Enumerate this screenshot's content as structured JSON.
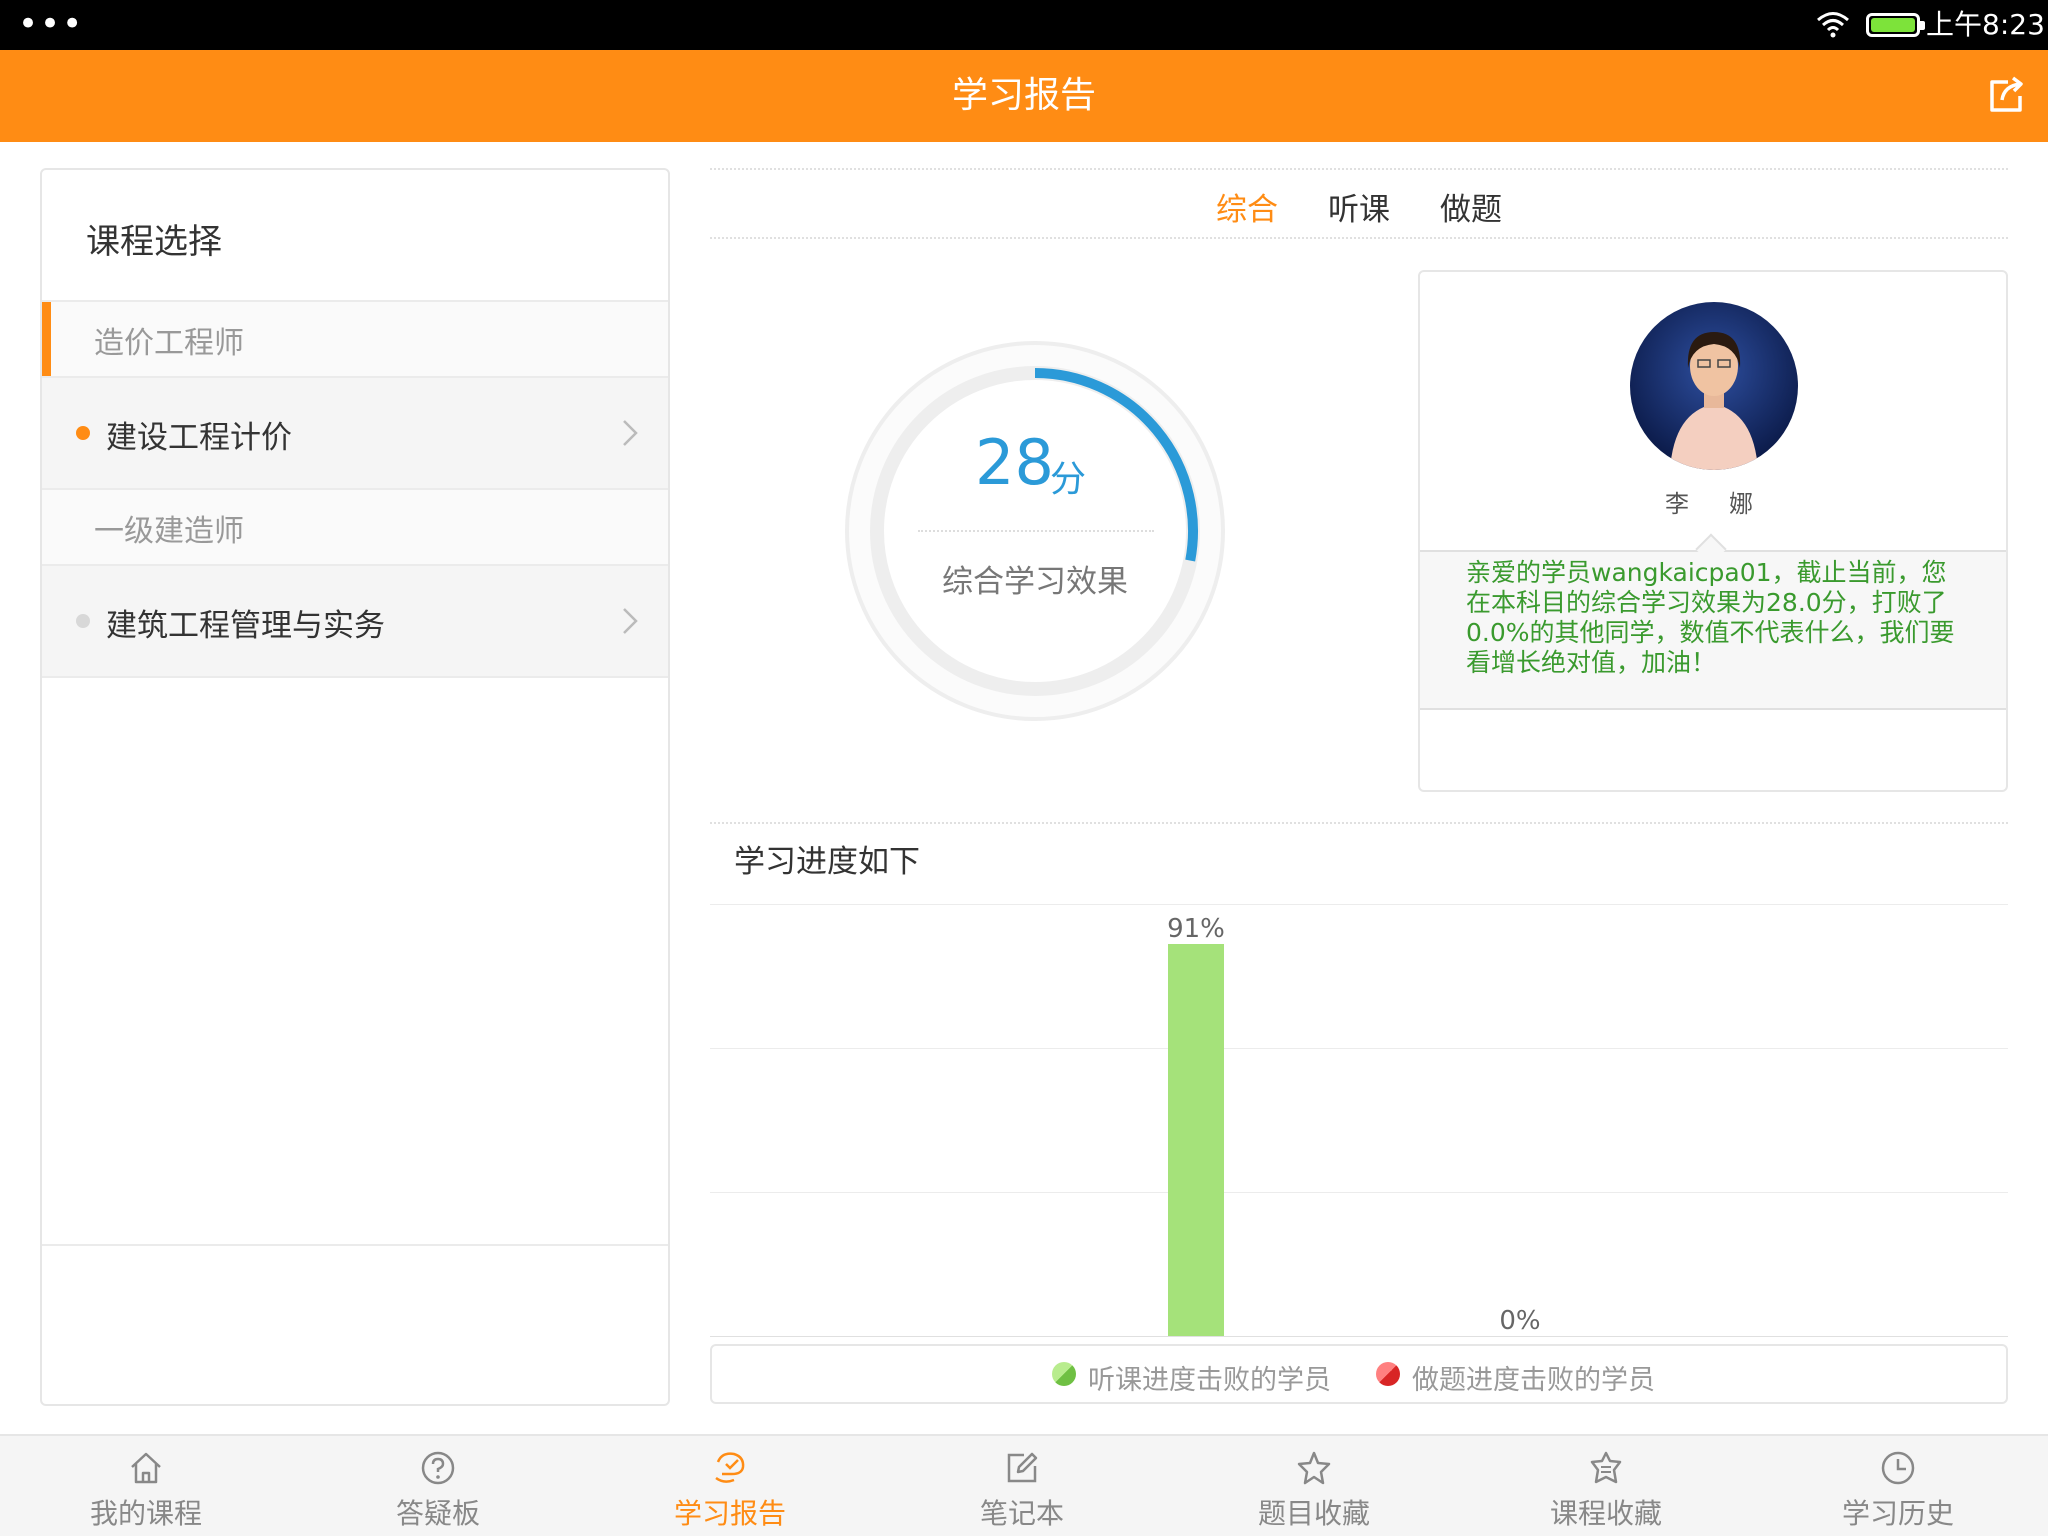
{
  "status_bar": {
    "time": "上午8:23",
    "menu_dots": "•••"
  },
  "header": {
    "title": "学习报告",
    "share_icon": "share-icon"
  },
  "left_panel": {
    "title": "课程选择",
    "groups": [
      {
        "category": "造价工程师",
        "course": "建设工程计价",
        "active": true
      },
      {
        "category": "一级建造师",
        "course": "建筑工程管理与实务",
        "active": false
      }
    ]
  },
  "tabs": [
    {
      "label": "综合",
      "active": true
    },
    {
      "label": "听课",
      "active": false
    },
    {
      "label": "做题",
      "active": false
    }
  ],
  "score": {
    "value": "28",
    "unit": "分",
    "label": "综合学习效果",
    "fraction": 0.28
  },
  "teacher": {
    "name": "李　娜",
    "message": "亲爱的学员wangkaicpa01，截止当前，您在本科目的综合学习效果为28.0分，打败了0.0%的其他同学，数值不代表什么，我们要看增长绝对值，加油！"
  },
  "progress": {
    "title": "学习进度如下",
    "legend": [
      {
        "label": "听课进度击败的学员",
        "color": "#8fd65a"
      },
      {
        "label": "做题进度击败的学员",
        "color": "#ef3b3b"
      }
    ]
  },
  "chart_data": {
    "type": "bar",
    "categories": [
      "听课进度击败的学员",
      "做题进度击败的学员"
    ],
    "values": [
      91,
      0
    ],
    "value_labels": [
      "91%",
      "0%"
    ],
    "ylim": [
      0,
      100
    ],
    "colors": [
      "#a5e27a",
      "#ef3b3b"
    ]
  },
  "bottom_nav": [
    {
      "label": "我的课程",
      "icon": "home-icon",
      "active": false
    },
    {
      "label": "答疑板",
      "icon": "question-icon",
      "active": false
    },
    {
      "label": "学习报告",
      "icon": "report-icon",
      "active": true
    },
    {
      "label": "笔记本",
      "icon": "edit-icon",
      "active": false
    },
    {
      "label": "题目收藏",
      "icon": "star-icon",
      "active": false
    },
    {
      "label": "课程收藏",
      "icon": "course-favorite-icon",
      "active": false
    },
    {
      "label": "学习历史",
      "icon": "clock-icon",
      "active": false
    }
  ],
  "colors": {
    "accent": "#ff8c14",
    "score_blue": "#2b9ad8",
    "message_green": "#3a9a2e"
  }
}
